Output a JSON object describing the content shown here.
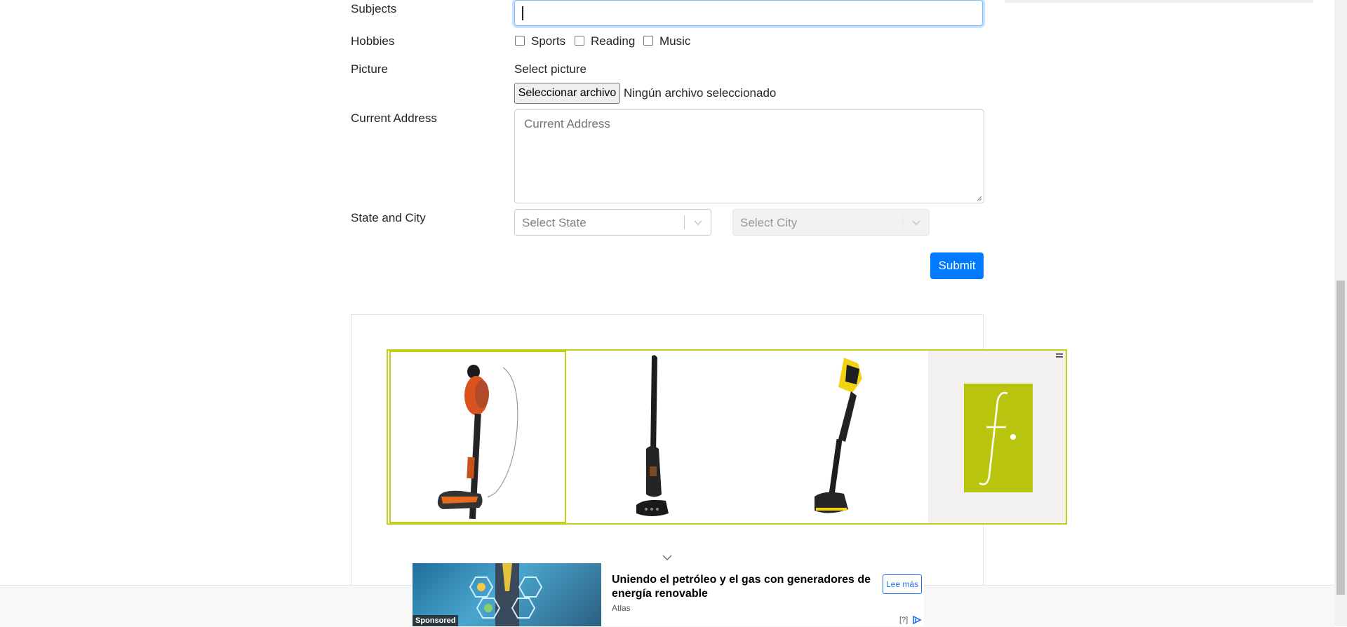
{
  "form": {
    "subjects_label": "Subjects",
    "subjects_value": "",
    "hobbies_label": "Hobbies",
    "hobbies": [
      {
        "label": "Sports",
        "checked": false
      },
      {
        "label": "Reading",
        "checked": false
      },
      {
        "label": "Music",
        "checked": false
      }
    ],
    "picture_label": "Picture",
    "picture_hint": "Select picture",
    "file_button_label": "Seleccionar archivo",
    "file_status": "Ningún archivo seleccionado",
    "address_label": "Current Address",
    "address_placeholder": "Current Address",
    "state_city_label": "State and City",
    "state_placeholder": "Select State",
    "city_placeholder": "Select City",
    "submit_label": "Submit"
  },
  "ad_banner": {
    "products": [
      "vacuum-1",
      "vacuum-2",
      "vacuum-3"
    ],
    "brand_logo": "f."
  },
  "native_ad": {
    "sponsored_label": "Sponsored",
    "title": "Uniendo el petróleo y el gas con generadores de energía renovable",
    "source": "Atlas",
    "cta_label": "Lee más",
    "help_label": "[?]"
  },
  "colors": {
    "accent": "#007bff",
    "focus_border": "#80bdff",
    "ad_border": "#c4cf1c",
    "logo_green": "#b8c40d"
  }
}
